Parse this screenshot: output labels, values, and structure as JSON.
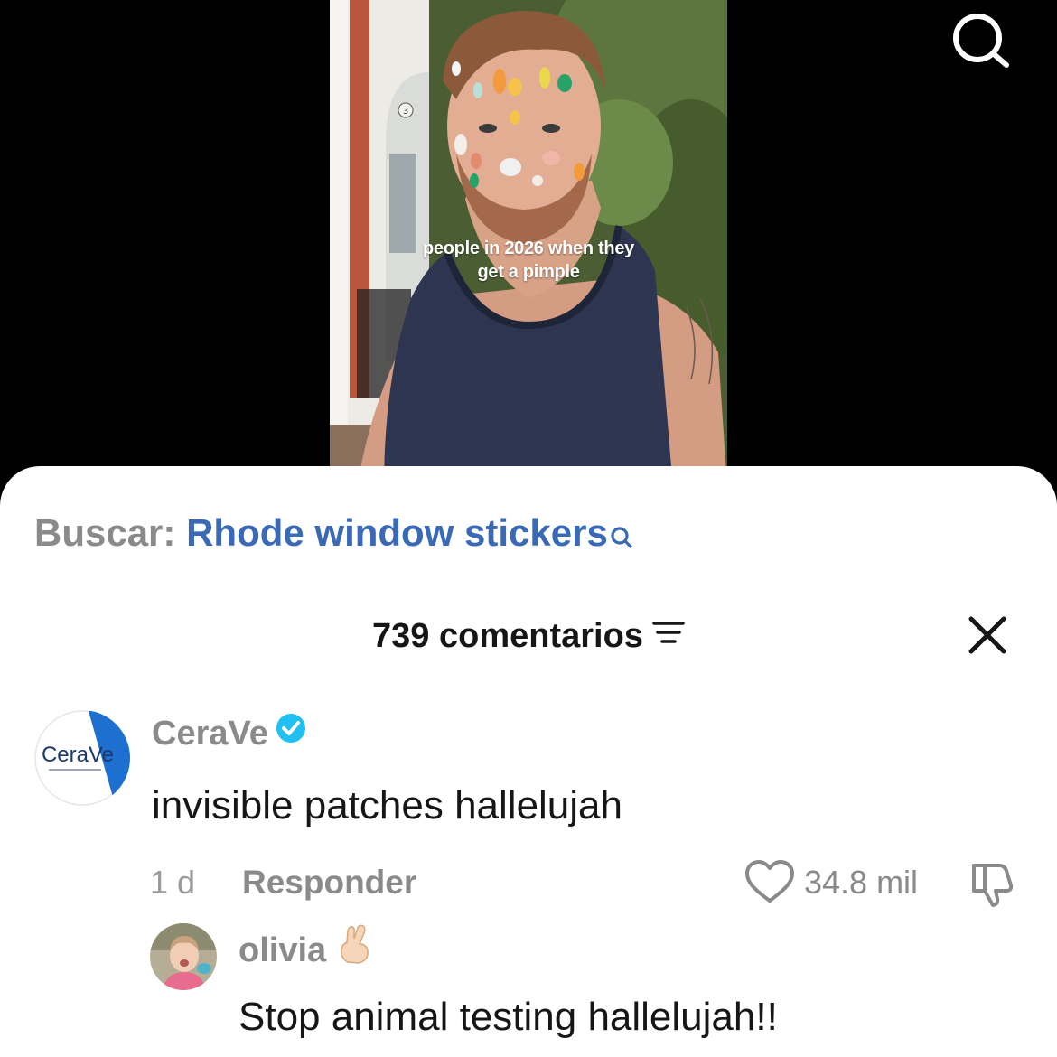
{
  "video": {
    "caption": "people in 2026 when they\nget a pimple",
    "door_number": "3"
  },
  "top_bar": {
    "search_icon": "search-icon"
  },
  "search_suggestion": {
    "prefix": "Buscar:",
    "query": "Rhode window stickers",
    "icon": "search-icon"
  },
  "comments_header": {
    "count_label": "739 comentarios",
    "sort_icon": "sort-icon",
    "close_icon": "close-icon"
  },
  "comments": [
    {
      "username": "CeraVe",
      "verified": true,
      "avatar_brand": "CeraVe",
      "text": "invisible patches hallelujah",
      "time": "1 d",
      "reply_label": "Responder",
      "likes": "34.8 mil"
    },
    {
      "username": "olivia",
      "emoji": "crossed-fingers",
      "text": "Stop animal testing hallelujah!!"
    }
  ],
  "colors": {
    "link_blue": "#3a6ab6",
    "verified_blue": "#20c0f0",
    "secondary_gray": "#8a8a8a",
    "text_dark": "#161616",
    "brand_blue": "#1d6fd0"
  }
}
